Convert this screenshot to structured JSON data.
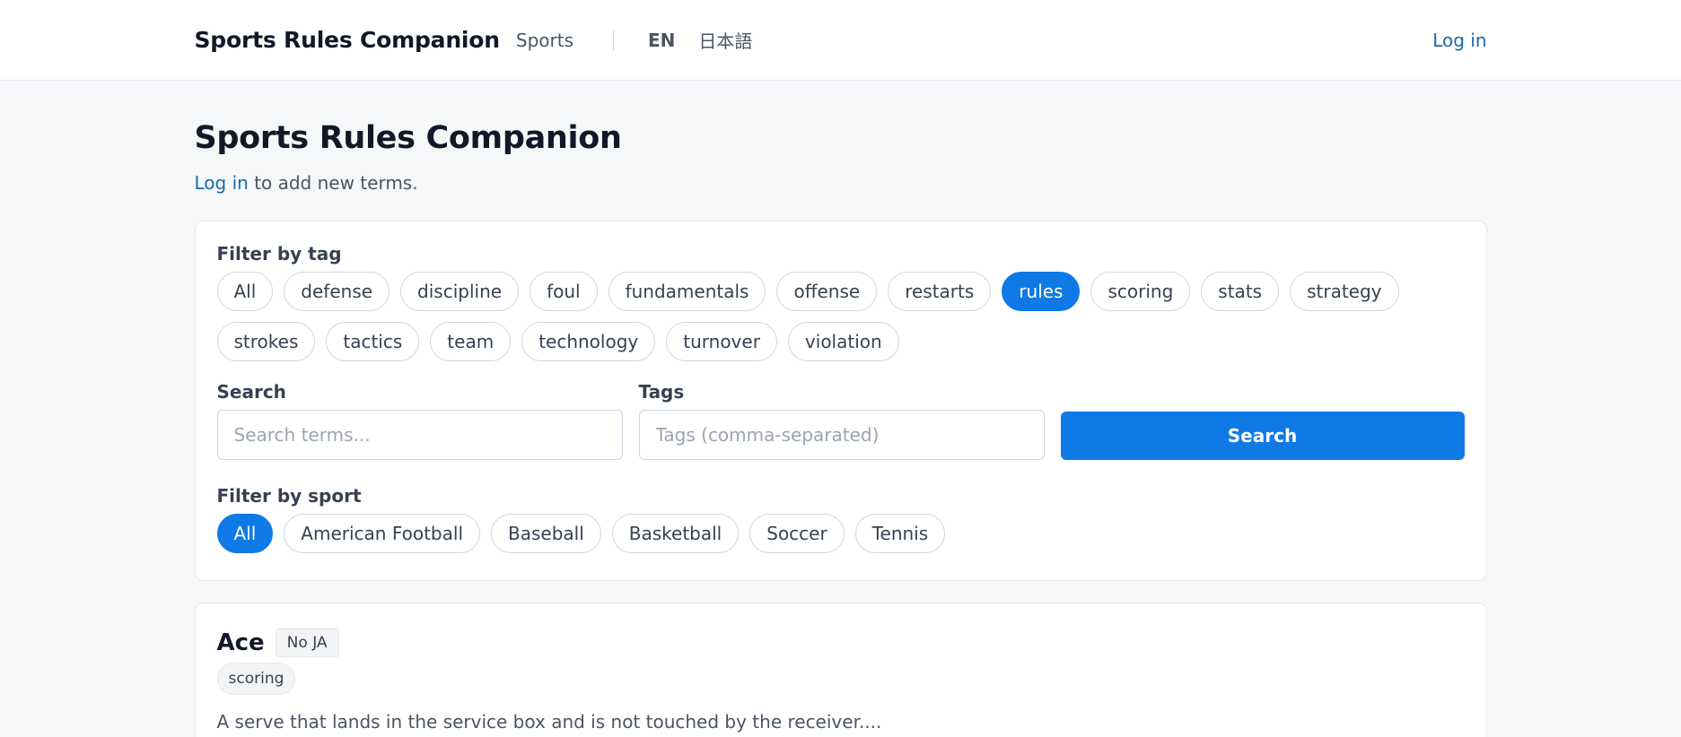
{
  "header": {
    "brand": "Sports Rules Companion",
    "nav_sports": "Sports",
    "lang_en": "EN",
    "lang_ja": "日本語",
    "login": "Log in"
  },
  "page": {
    "title": "Sports Rules Companion",
    "login_link": "Log in",
    "subtitle_rest": " to add new terms."
  },
  "filters": {
    "tag_label": "Filter by tag",
    "tags": [
      "All",
      "defense",
      "discipline",
      "foul",
      "fundamentals",
      "offense",
      "restarts",
      "rules",
      "scoring",
      "stats",
      "strategy",
      "strokes",
      "tactics",
      "team",
      "technology",
      "turnover",
      "violation"
    ],
    "active_tag": "rules",
    "search_label": "Search",
    "search_placeholder": "Search terms...",
    "tags_label": "Tags",
    "tags_placeholder": "Tags (comma-separated)",
    "search_button": "Search",
    "sport_label": "Filter by sport",
    "sports": [
      "All",
      "American Football",
      "Baseball",
      "Basketball",
      "Soccer",
      "Tennis"
    ],
    "active_sport": "All"
  },
  "terms": [
    {
      "name": "Ace",
      "badge": "No JA",
      "tag": "scoring",
      "description": "A serve that lands in the service box and is not touched by the receiver...."
    }
  ],
  "colors": {
    "accent": "#0f7ae5",
    "link": "#1a6aa8"
  }
}
